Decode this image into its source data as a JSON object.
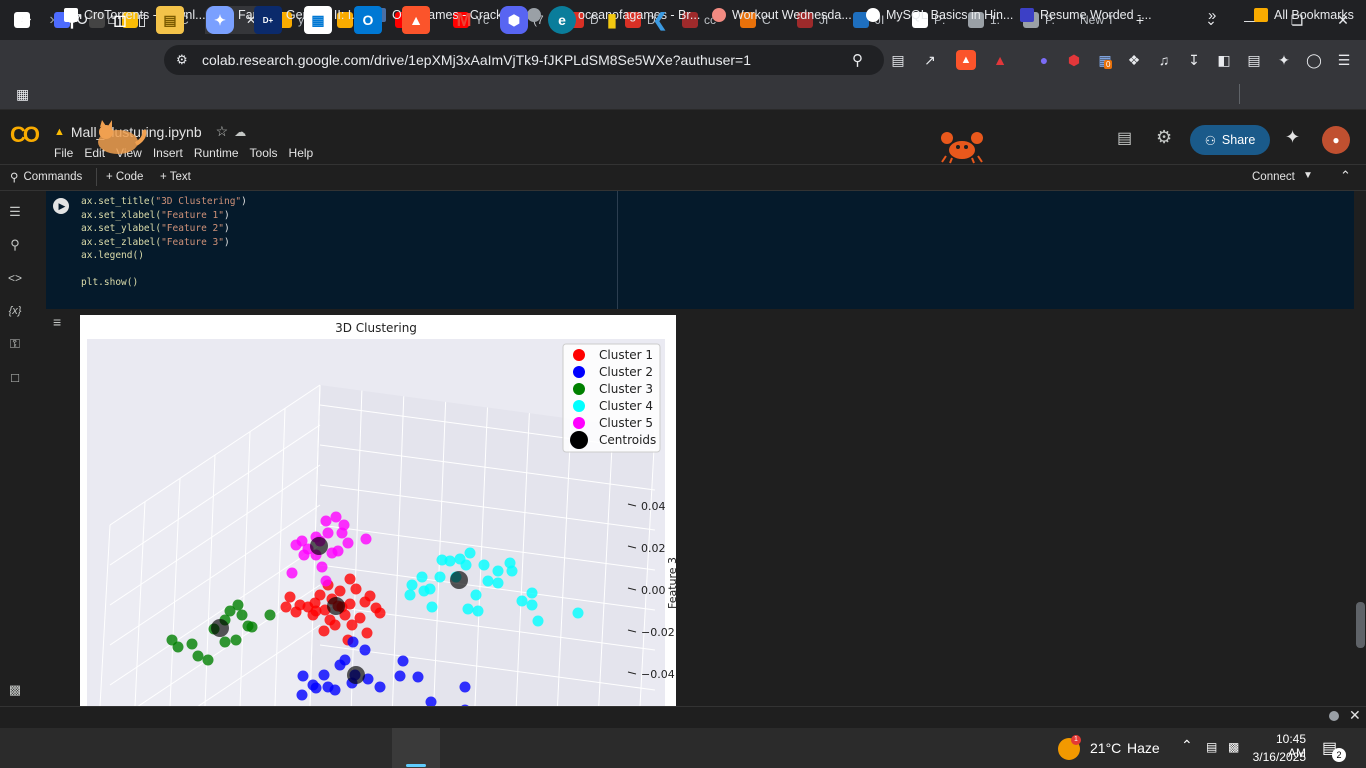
{
  "browser": {
    "tabs": [
      {
        "label": "",
        "icon": "chatgpt-icon",
        "color": "#ffffff"
      },
      {
        "label": "",
        "icon": "deepseek-icon",
        "color": "#4d6bfe"
      },
      {
        "label": "",
        "icon": "mg-icon",
        "color": "#444444"
      },
      {
        "label": "",
        "icon": "drive-icon",
        "color": "#fbbc04"
      },
      {
        "label": "C",
        "icon": "drive-icon",
        "color": "#0f9d58"
      },
      {
        "label": "M",
        "icon": "",
        "color": "#35363a",
        "active": true
      },
      {
        "label": "yc",
        "icon": "colab-icon",
        "color": "#f9ab00"
      },
      {
        "label": "St",
        "icon": "colab-icon",
        "color": "#f9ab00"
      },
      {
        "label": "(7",
        "icon": "youtube-icon",
        "color": "#ff0000"
      },
      {
        "label": "Yc",
        "icon": "youtube-icon",
        "color": "#ff0000"
      },
      {
        "label": "(7",
        "icon": "youtube-icon",
        "color": "#ff0000"
      },
      {
        "label": "D",
        "icon": "heart-icon",
        "color": "#d93025"
      },
      {
        "label": "D",
        "icon": "heart-icon",
        "color": "#d93025"
      },
      {
        "label": "cc",
        "icon": "site-icon",
        "color": "#9e2a2b"
      },
      {
        "label": "C",
        "icon": "cc-icon",
        "color": "#e8710a"
      },
      {
        "label": "JI",
        "icon": "site-icon",
        "color": "#9e2a2b"
      },
      {
        "label": "JI",
        "icon": "java-icon",
        "color": "#1e6fbf"
      },
      {
        "label": "P:",
        "icon": "github-icon",
        "color": "#ffffff"
      },
      {
        "label": "1:",
        "icon": "globe-icon",
        "color": "#9aa0a6"
      },
      {
        "label": "P.",
        "icon": "globe-icon",
        "color": "#9aa0a6"
      },
      {
        "label": "New T",
        "icon": "",
        "color": ""
      }
    ],
    "url": "colab.research.google.com/drive/1epXMj3xAaImVjTk9-fJKPLdSM8Se5WXe?authuser=1",
    "extension_badge": "0",
    "bookmarks": [
      {
        "label": "CroTorrents - Downl...",
        "color": "#ffffff"
      },
      {
        "label": "Fantasy General II: I...",
        "color": "#ffffff"
      },
      {
        "label": "Ova Games - Crack...",
        "color": "#4a6fa5"
      },
      {
        "label": "",
        "color": "#9aa0a6"
      },
      {
        "label": "oceanofagames - Br...",
        "color": "#9e2a2b"
      },
      {
        "label": "Workout Wednesda...",
        "color": "#f28b82"
      },
      {
        "label": "MySQL Basics in Hin...",
        "color": "#ffffff"
      },
      {
        "label": "Resume Worded -...",
        "color": "#3c40c6"
      }
    ],
    "all_bookmarks": "All Bookmarks"
  },
  "colab": {
    "notebook_name": "Mall_clusturing.ipynb",
    "menu": [
      "File",
      "Edit",
      "View",
      "Insert",
      "Runtime",
      "Tools",
      "Help"
    ],
    "share_label": "Share",
    "commands_label": "Commands",
    "add_code_label": "+ Code",
    "add_text_label": "+ Text",
    "connect_label": "Connect"
  },
  "code_lines": [
    {
      "fn": "ax.set_title(",
      "str": "\"3D Clustering\"",
      "end": ")"
    },
    {
      "fn": "ax.set_xlabel(",
      "str": "\"Feature 1\"",
      "end": ")"
    },
    {
      "fn": "ax.set_ylabel(",
      "str": "\"Feature 2\"",
      "end": ")"
    },
    {
      "fn": "ax.set_zlabel(",
      "str": "\"Feature 3\"",
      "end": ")"
    },
    {
      "fn": "ax.legend()",
      "str": "",
      "end": ""
    },
    {
      "fn": "",
      "str": "",
      "end": ""
    },
    {
      "fn": "plt.show()",
      "str": "",
      "end": ""
    }
  ],
  "chart_data": {
    "type": "scatter",
    "title": "3D Clustering",
    "zlabel": "Feature 3",
    "z_ticks": [
      "0.04",
      "0.02",
      "0.00",
      "−0.02",
      "−0.04"
    ],
    "series": [
      {
        "name": "Cluster 1",
        "color": "#ff0000"
      },
      {
        "name": "Cluster 2",
        "color": "#0000ff"
      },
      {
        "name": "Cluster 3",
        "color": "#008000"
      },
      {
        "name": "Cluster 4",
        "color": "#00ffff"
      },
      {
        "name": "Cluster 5",
        "color": "#ff00ff"
      },
      {
        "name": "Centroids",
        "color": "#000000"
      }
    ],
    "legend_position": "top-right",
    "grid": true
  },
  "status": {
    "weather_temp": "21°C",
    "weather_desc": "Haze",
    "weather_badge": "1",
    "time": "10:45 AM",
    "date": "3/16/2025",
    "notification_count": "2"
  }
}
